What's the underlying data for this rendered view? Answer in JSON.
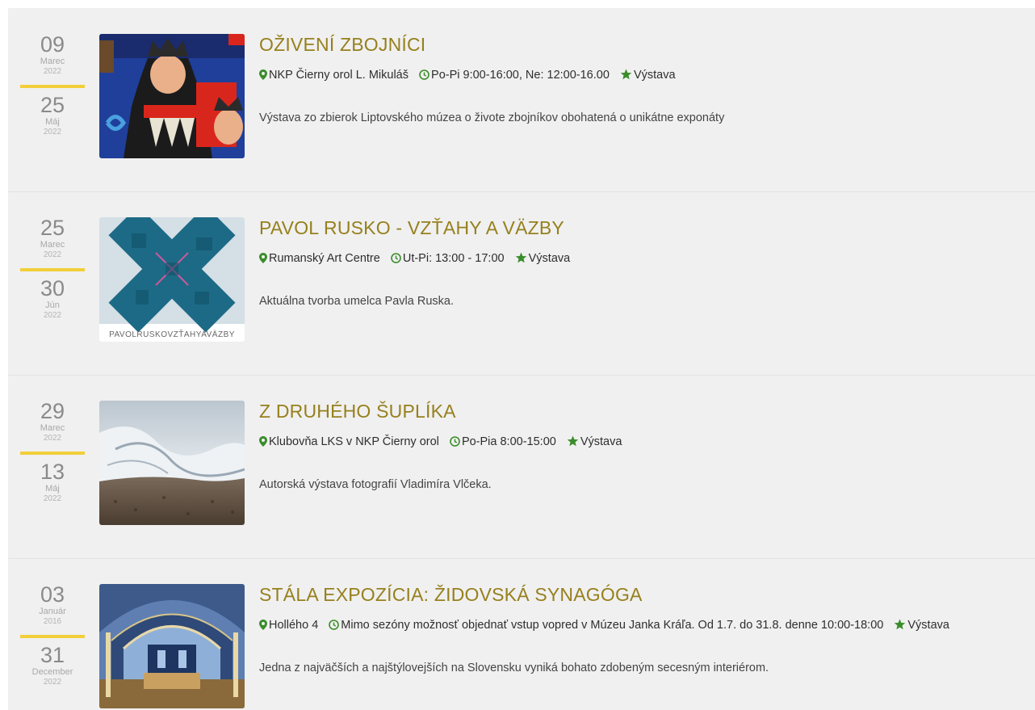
{
  "events": [
    {
      "start": {
        "day": "09",
        "month": "Marec",
        "year": "2022"
      },
      "end": {
        "day": "25",
        "month": "Máj",
        "year": "2022"
      },
      "title": "OŽIVENÍ ZBOJNÍCI",
      "location": "NKP Čierny orol L. Mikuláš",
      "hours": "Po-Pi 9:00-16:00, Ne: 12:00-16.00",
      "category": "Výstava",
      "description": "Výstava zo zbierok Liptovského múzea o živote zbojníkov obohatená o unikátne exponáty"
    },
    {
      "start": {
        "day": "25",
        "month": "Marec",
        "year": "2022"
      },
      "end": {
        "day": "30",
        "month": "Jún",
        "year": "2022"
      },
      "title": "PAVOL RUSKO - VZŤAHY A VÄZBY",
      "location": "Rumanský Art Centre",
      "hours": "Ut-Pi: 13:00 - 17:00",
      "category": "Výstava",
      "description": "Aktuálna tvorba umelca Pavla Ruska.",
      "thumb_caption": "PAVOLRUSKOVZŤAHYAVÄZBY"
    },
    {
      "start": {
        "day": "29",
        "month": "Marec",
        "year": "2022"
      },
      "end": {
        "day": "13",
        "month": "Máj",
        "year": "2022"
      },
      "title": "Z DRUHÉHO ŠUPLÍKA",
      "location": "Klubovňa LKS v NKP Čierny orol",
      "hours": "Po-Pia 8:00-15:00",
      "category": "Výstava",
      "description": "Autorská výstava fotografií Vladimíra Vlčeka."
    },
    {
      "start": {
        "day": "03",
        "month": "Január",
        "year": "2016"
      },
      "end": {
        "day": "31",
        "month": "December",
        "year": "2022"
      },
      "title": "STÁLA EXPOZÍCIA: ŽIDOVSKÁ SYNAGÓGA",
      "location": "Hollého 4",
      "hours": "Mimo sezóny možnosť objednať vstup vopred v Múzeu Janka Kráľa. Od 1.7. do 31.8. denne 10:00-18:00",
      "category": "Výstava",
      "description": "Jedna z najväčších a najštýlovejších na Slovensku vyniká bohato zdobeným secesným interiérom."
    }
  ],
  "colors": {
    "accent_title": "#96801d",
    "icon_green": "#3a8d2a",
    "date_divider": "#f2cf3a",
    "background": "#f0f0f0"
  },
  "icons": {
    "location": "map-marker-icon",
    "time": "clock-icon",
    "category": "star-icon"
  }
}
